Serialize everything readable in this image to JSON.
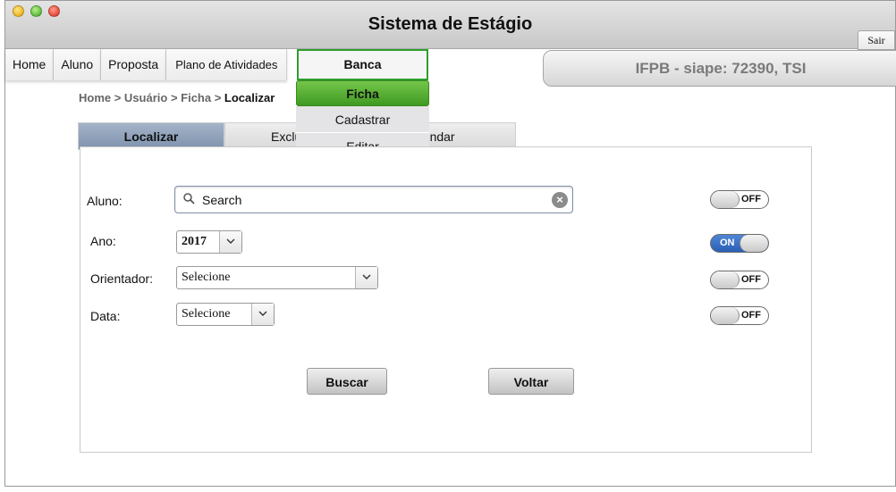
{
  "window": {
    "title": "Sistema de Estágio",
    "sair_label": "Sair"
  },
  "nav": {
    "items": [
      "Home",
      "Aluno",
      "Proposta",
      "Plano de Atividades"
    ],
    "banca_label": "Banca"
  },
  "dropdown": {
    "items": [
      "Ficha",
      "Cadastrar",
      "Editar"
    ],
    "active": "Ficha"
  },
  "user_info": "IFPB - siape: 72390, TSI",
  "breadcrumb": {
    "trail": "Home > Usuário > Ficha > ",
    "current": "Localizar"
  },
  "tabs": [
    "Localizar",
    "Exclu",
    "gendar"
  ],
  "form": {
    "aluno_label": "Aluno:",
    "search_placeholder": "Search",
    "ano_label": "Ano:",
    "ano_value": "2017",
    "orientador_label": "Orientador:",
    "orientador_value": "Selecione",
    "data_label": "Data:",
    "data_value": "Selecione"
  },
  "toggles": {
    "aluno": "OFF",
    "ano": "ON",
    "orientador": "OFF",
    "data": "OFF"
  },
  "buttons": {
    "buscar": "Buscar",
    "voltar": "Voltar"
  },
  "colors": {
    "active_green": "#4caf2d",
    "toggle_on_blue": "#2a5fb4",
    "active_tab": "#8a9db6"
  }
}
